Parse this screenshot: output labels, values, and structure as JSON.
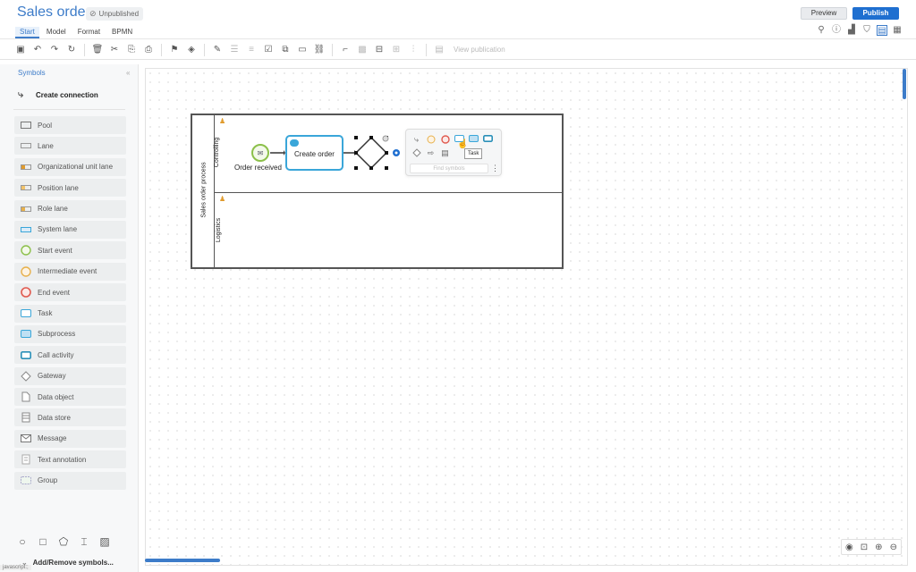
{
  "header": {
    "title": "Sales order",
    "status_badge": "Unpublished",
    "tabs": [
      {
        "label": "Start",
        "active": true
      },
      {
        "label": "Model",
        "active": false
      },
      {
        "label": "Format",
        "active": false
      },
      {
        "label": "BPMN",
        "active": false
      }
    ],
    "preview_label": "Preview",
    "publish_label": "Publish",
    "right_icons": [
      "search-icon",
      "info-icon",
      "chart-icon",
      "shield-icon",
      "form-view-icon",
      "table-view-icon"
    ]
  },
  "toolbar": {
    "view_publication_label": "View publication"
  },
  "sidebar": {
    "title": "Symbols",
    "create_connection_label": "Create connection",
    "symbols": [
      {
        "label": "Pool",
        "icon": "pool-icon"
      },
      {
        "label": "Lane",
        "icon": "lane-icon"
      },
      {
        "label": "Organizational unit lane",
        "icon": "org-unit-lane-icon"
      },
      {
        "label": "Position lane",
        "icon": "position-lane-icon"
      },
      {
        "label": "Role lane",
        "icon": "role-lane-icon"
      },
      {
        "label": "System lane",
        "icon": "system-lane-icon"
      },
      {
        "label": "Start event",
        "icon": "start-event-icon"
      },
      {
        "label": "Intermediate event",
        "icon": "intermediate-event-icon"
      },
      {
        "label": "End event",
        "icon": "end-event-icon"
      },
      {
        "label": "Task",
        "icon": "task-icon"
      },
      {
        "label": "Subprocess",
        "icon": "subprocess-icon"
      },
      {
        "label": "Call activity",
        "icon": "call-activity-icon"
      },
      {
        "label": "Gateway",
        "icon": "gateway-icon"
      },
      {
        "label": "Data object",
        "icon": "data-object-icon"
      },
      {
        "label": "Data store",
        "icon": "data-store-icon"
      },
      {
        "label": "Message",
        "icon": "message-icon"
      },
      {
        "label": "Text annotation",
        "icon": "text-annotation-icon"
      },
      {
        "label": "Group",
        "icon": "group-icon"
      }
    ],
    "add_remove_label": "Add/Remove symbols..."
  },
  "diagram": {
    "pool_label": "Sales order process",
    "lanes": [
      {
        "label": "Controlling"
      },
      {
        "label": "Logistics"
      }
    ],
    "start_event_label": "Order received",
    "task_label": "Create order",
    "popup_search_placeholder": "Find symbols",
    "tooltip": "Task"
  },
  "statusbar": {
    "text": "javascript:;"
  },
  "colors": {
    "accent": "#3d7cc9",
    "publish": "#1f6fd0",
    "task_border": "#3aa6d9",
    "start_event": "#8cc04a",
    "end_event": "#e05a4f",
    "lane_icon": "#e09b2d"
  }
}
